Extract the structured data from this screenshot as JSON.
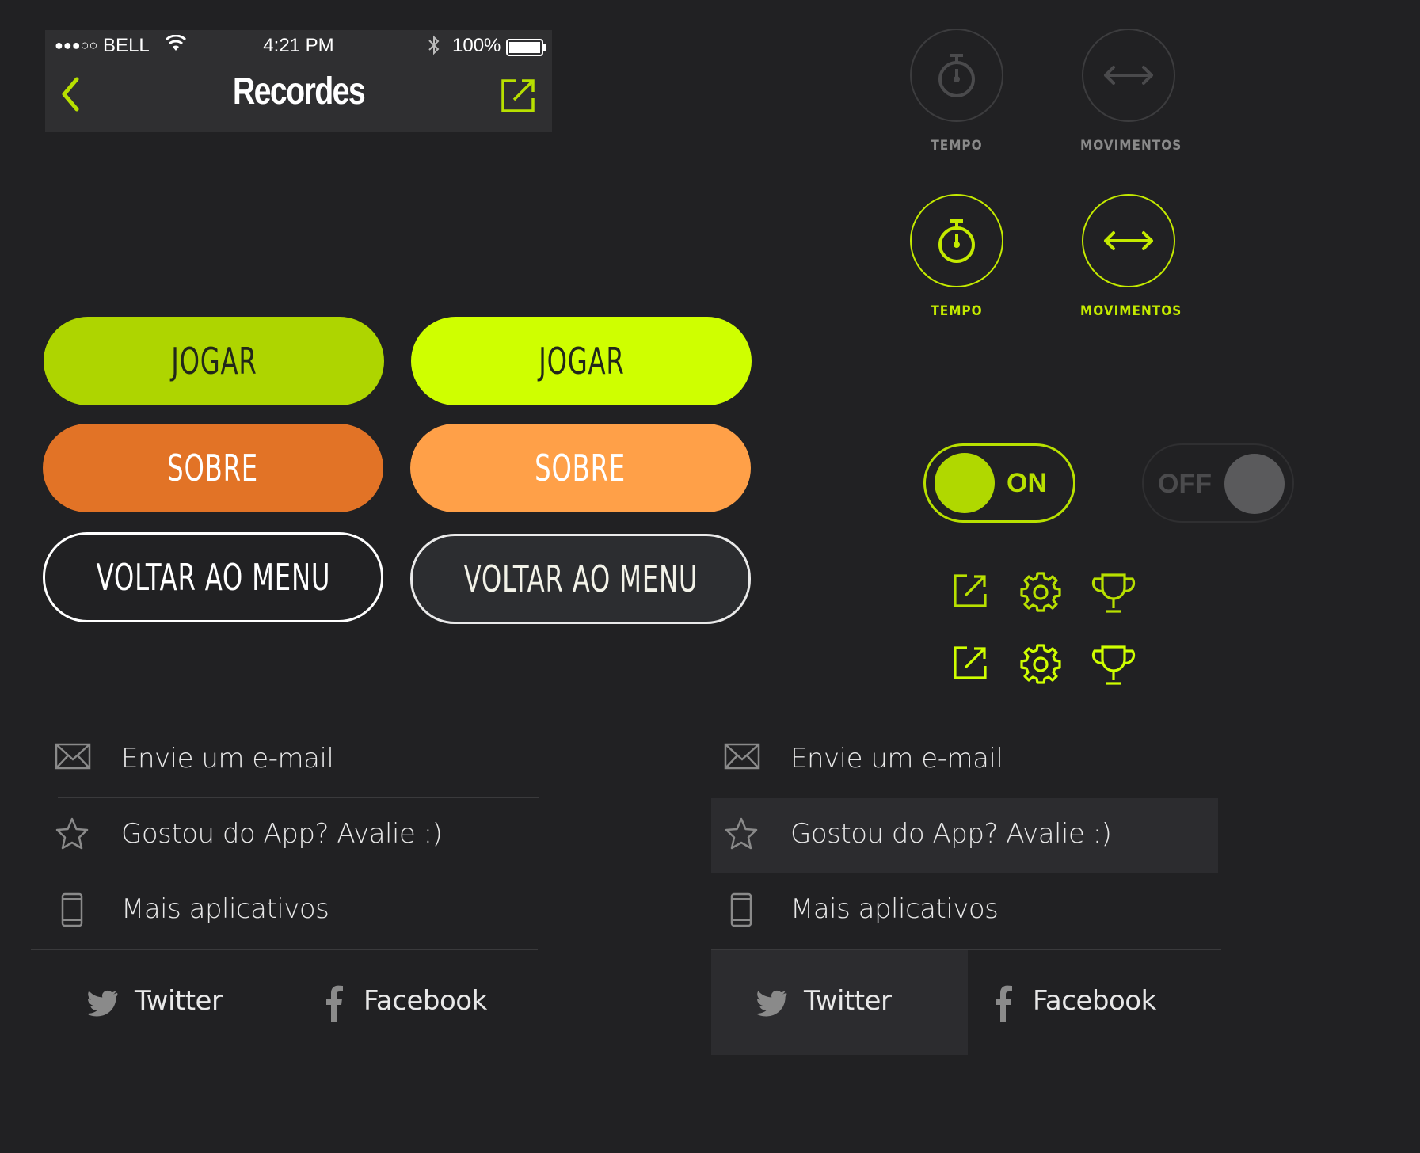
{
  "status_bar": {
    "carrier": "BELL",
    "signal": "●●●○○",
    "time": "4:21 PM",
    "battery": "100%"
  },
  "nav": {
    "title": "Recordes",
    "back_icon": "chevron-left-icon",
    "share_icon": "share-icon"
  },
  "buttons": {
    "play": "JOGAR",
    "about": "SOBRE",
    "back_to_menu": "VOLTAR AO MENU"
  },
  "modes": {
    "time": "TEMPO",
    "moves": "MOVIMENTOS"
  },
  "toggles": {
    "on": "ON",
    "off": "OFF"
  },
  "menu": {
    "email": "Envie um e-mail",
    "rate": "Gostou do App? Avalie :)",
    "more_apps": "Mais aplicativos",
    "twitter": "Twitter",
    "facebook": "Facebook"
  },
  "colors": {
    "background": "#212123",
    "lime": "#aed500",
    "lime_bright": "#cfff00",
    "orange": "#e27326",
    "orange_light": "#ffa048",
    "accent_icon": "#c4ea00"
  }
}
